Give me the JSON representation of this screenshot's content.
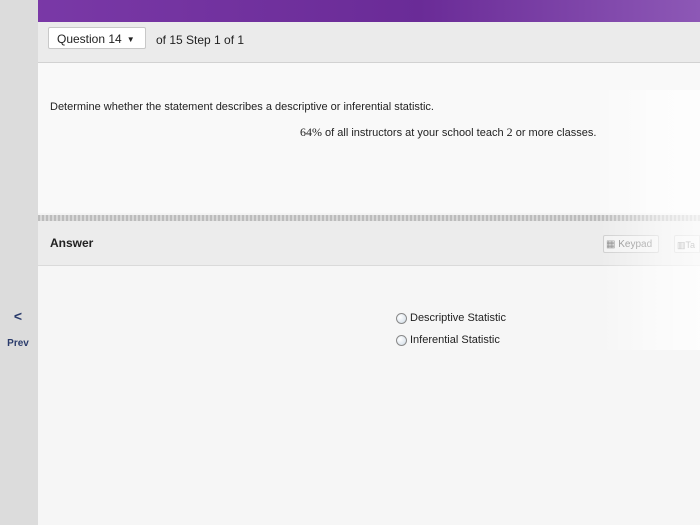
{
  "header": {
    "question_select": "Question 14",
    "progress_text": "of 15 Step 1 of 1"
  },
  "question": {
    "prompt": "Determine whether the statement describes a descriptive or inferential statistic.",
    "statement_percent": "64%",
    "statement_middle": " of all instructors at your school teach ",
    "statement_number": "2",
    "statement_end": " or more classes."
  },
  "answer": {
    "label": "Answer",
    "keypad_label": "Keypad",
    "tables_label": "Ta",
    "options": [
      "Descriptive Statistic",
      "Inferential Statistic"
    ]
  },
  "nav": {
    "prev_label": "Prev",
    "prev_chevron": "<"
  }
}
